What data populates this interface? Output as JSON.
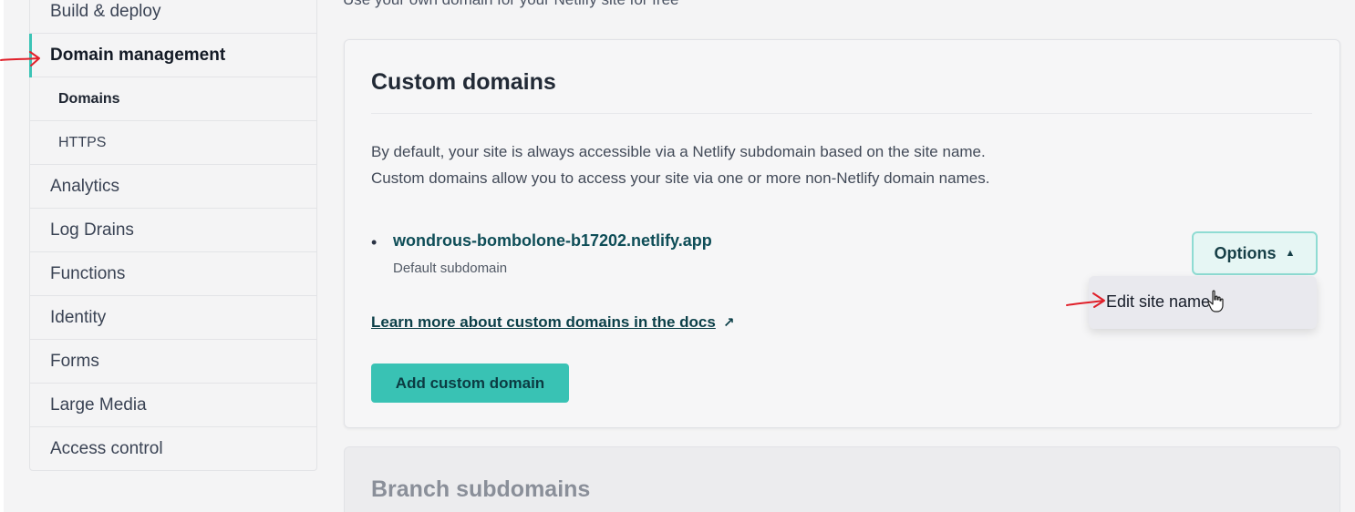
{
  "colors": {
    "accent": "#39c2b4",
    "active_bar": "#3cc4b6",
    "annotation": "#e0202a"
  },
  "sidebar": {
    "items": [
      {
        "label": "Build & deploy"
      },
      {
        "label": "Domain management"
      },
      {
        "label": "Domains"
      },
      {
        "label": "HTTPS"
      },
      {
        "label": "Analytics"
      },
      {
        "label": "Log Drains"
      },
      {
        "label": "Functions"
      },
      {
        "label": "Identity"
      },
      {
        "label": "Forms"
      },
      {
        "label": "Large Media"
      },
      {
        "label": "Access control"
      }
    ]
  },
  "main": {
    "subheading": "Use your own domain for your Netlify site for free",
    "custom_domains": {
      "title": "Custom domains",
      "desc_line1": "By default, your site is always accessible via a Netlify subdomain based on the site name.",
      "desc_line2": "Custom domains allow you to access your site via one or more non-Netlify domain names.",
      "domain": "wondrous-bombolone-b17202.netlify.app",
      "domain_sub": "Default subdomain",
      "docs_link": "Learn more about custom domains in the docs",
      "add_button": "Add custom domain",
      "options_button": "Options",
      "menu_item": "Edit site name"
    },
    "branch_subdomains": {
      "title": "Branch subdomains"
    }
  }
}
